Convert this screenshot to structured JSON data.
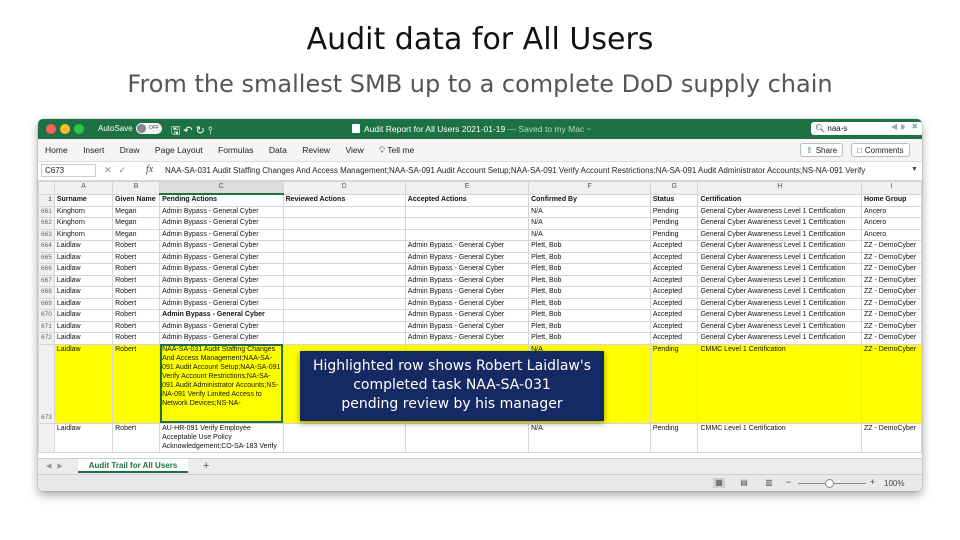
{
  "slide": {
    "title": "Audit data for All Users",
    "subtitle": "From the smallest SMB up to a complete DoD supply chain"
  },
  "titlebar": {
    "autosave_label": "AutoSave",
    "autosave_state": "OFF",
    "document_title": "Audit Report for All Users 2021-01-19",
    "saved_status": "— Saved to my Mac ~",
    "search_value": "naa-s"
  },
  "ribbon": {
    "tabs": [
      "Home",
      "Insert",
      "Draw",
      "Page Layout",
      "Formulas",
      "Data",
      "Review",
      "View",
      "Tell me"
    ],
    "share_label": "Share",
    "comments_label": "Comments"
  },
  "formula_bar": {
    "cell_ref": "C673",
    "formula": "NAA-SA-031 Audit Staffing Changes And Access Management;NAA-SA-091 Audit Account Setup;NAA-SA-091 Verify Account Restrictions;NA-SA-091 Audit Administrator Accounts;NS-NA-091 Verify"
  },
  "sheet": {
    "col_letters": [
      "",
      "A",
      "B",
      "C",
      "D",
      "E",
      "F",
      "G",
      "H",
      "I"
    ],
    "headers": [
      "1",
      "Surname",
      "Given Name",
      "Pending Actions",
      "Reviewed Actions",
      "Accepted Actions",
      "Confirmed By",
      "Status",
      "Certification",
      "Home Group"
    ],
    "rows": [
      [
        "661",
        "Kinghorn",
        "Megan",
        "Admin Bypass - General Cyber",
        "",
        "",
        "N/A",
        "Pending",
        "General Cyber Awareness Level 1 Certification",
        "Ancero"
      ],
      [
        "662",
        "Kinghorn",
        "Megan",
        "Admin Bypass - General Cyber",
        "",
        "",
        "N/A",
        "Pending",
        "General Cyber Awareness Level 1 Certification",
        "Ancero"
      ],
      [
        "663",
        "Kinghorn",
        "Megan",
        "Admin Bypass - General Cyber",
        "",
        "",
        "N/A",
        "Pending",
        "General Cyber Awareness Level 1 Certification",
        "Ancero"
      ],
      [
        "664",
        "Laidlaw",
        "Robert",
        "Admin Bypass - General Cyber",
        "",
        "Admin Bypass - General Cyber",
        "Plett, Bob",
        "Accepted",
        "General Cyber Awareness Level 1 Certification",
        "ZZ - DemoCyber"
      ],
      [
        "665",
        "Laidlaw",
        "Robert",
        "Admin Bypass - General Cyber",
        "",
        "Admin Bypass - General Cyber",
        "Plett, Bob",
        "Accepted",
        "General Cyber Awareness Level 1 Certification",
        "ZZ - DemoCyber"
      ],
      [
        "666",
        "Laidlaw",
        "Robert",
        "Admin Bypass - General Cyber",
        "",
        "Admin Bypass - General Cyber",
        "Plett, Bob",
        "Accepted",
        "General Cyber Awareness Level 1 Certification",
        "ZZ - DemoCyber"
      ],
      [
        "667",
        "Laidlaw",
        "Robert",
        "Admin Bypass - General Cyber",
        "",
        "Admin Bypass - General Cyber",
        "Plett, Bob",
        "Accepted",
        "General Cyber Awareness Level 1 Certification",
        "ZZ - DemoCyber"
      ],
      [
        "668",
        "Laidlaw",
        "Robert",
        "Admin Bypass - General Cyber",
        "",
        "Admin Bypass - General Cyber",
        "Plett, Bob",
        "Accepted",
        "General Cyber Awareness Level 1 Certification",
        "ZZ - DemoCyber"
      ],
      [
        "669",
        "Laidlaw",
        "Robert",
        "Admin Bypass - General Cyber",
        "",
        "Admin Bypass - General Cyber",
        "Plett, Bob",
        "Accepted",
        "General Cyber Awareness Level 1 Certification",
        "ZZ - DemoCyber"
      ],
      [
        "670",
        "Laidlaw",
        "Robert",
        "Admin Bypass - General Cyber",
        "",
        "Admin Bypass - General Cyber",
        "Plett, Bob",
        "Accepted",
        "General Cyber Awareness Level 1 Certification",
        "ZZ - DemoCyber"
      ],
      [
        "671",
        "Laidlaw",
        "Robert",
        "Admin Bypass - General Cyber",
        "",
        "Admin Bypass - General Cyber",
        "Plett, Bob",
        "Accepted",
        "General Cyber Awareness Level 1 Certification",
        "ZZ - DemoCyber"
      ],
      [
        "672",
        "Laidlaw",
        "Robert",
        "Admin Bypass - General Cyber",
        "",
        "Admin Bypass - General Cyber",
        "Plett, Bob",
        "Accepted",
        "General Cyber Awareness Level 1 Certification",
        "ZZ - DemoCyber"
      ]
    ],
    "highlight_row": [
      "673",
      "Laidlaw",
      "Robert",
      "NAA-SA-031 Audit Staffing Changes And Access Management;NAA-SA-091 Audit Account Setup;NAA-SA-091 Verify Account Restrictions;NA-SA-091 Audit Administrator Accounts;NS-NA-091 Verify Limited Access to Network Devices;NS-NA-",
      "",
      "",
      "N/A",
      "Pending",
      "CMMC Level 1 Certification",
      "ZZ - DemoCyber"
    ],
    "last_row": [
      "",
      "Laidlaw",
      "Robert",
      "AU-HR-091 Verify Employee Acceptable Use Policy Acknowledgement;CO-SA-183 Verify",
      "",
      "",
      "N/A",
      "Pending",
      "CMMC Level 1 Certification",
      "ZZ - DemoCyber"
    ],
    "highlight_color": "#ffff00"
  },
  "callout": {
    "line1": "Highlighted row shows Robert Laidlaw's",
    "line2": "completed task NAA-SA-031",
    "line3": "pending review by his manager"
  },
  "sheet_tabs": {
    "active": "Audit Trail for All Users",
    "add": "+"
  },
  "status_bar": {
    "zoom": "100%"
  },
  "colors": {
    "excel_green": "#1e7145",
    "callout_bg": "#152a63"
  }
}
